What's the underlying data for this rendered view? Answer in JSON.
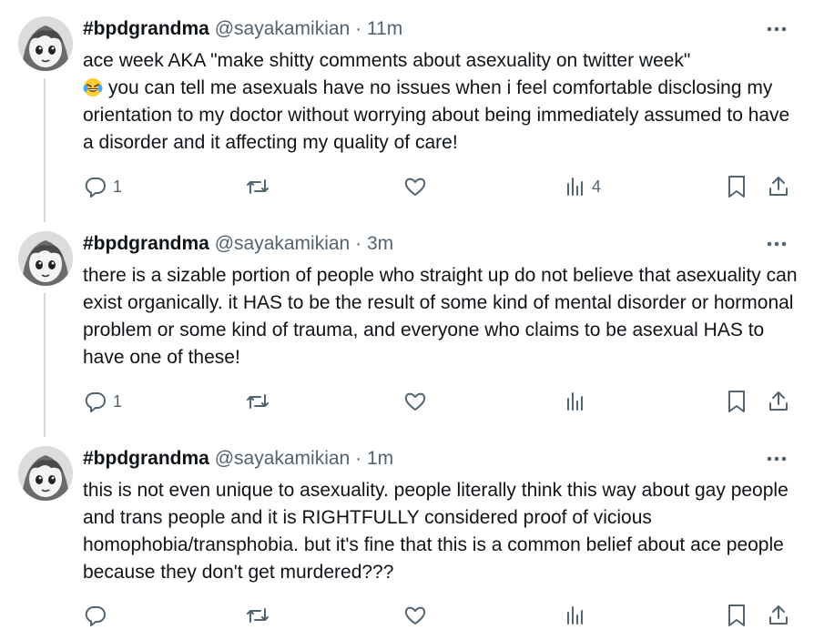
{
  "tweets": [
    {
      "name": "#bpdgrandma",
      "handle": "@sayakamikian",
      "separator": "·",
      "time": "11m",
      "text_before_emoji": "ace week AKA \"make shitty comments about asexuality on twitter week\"\n",
      "emoji": "😂",
      "text_after_emoji": " you can tell me asexuals have no issues when i feel comfortable disclosing my orientation to my doctor without worrying about being immediately assumed to have a disorder and it affecting my quality of care!",
      "reply_count": "1",
      "retweet_count": "",
      "like_count": "",
      "view_count": "4"
    },
    {
      "name": "#bpdgrandma",
      "handle": "@sayakamikian",
      "separator": "·",
      "time": "3m",
      "text": "there is a sizable portion of people who straight up do not believe that asexuality can exist organically. it HAS to be the result of some kind of mental disorder or hormonal problem or some kind of trauma, and everyone who claims to be asexual HAS to have one of these!",
      "reply_count": "1",
      "retweet_count": "",
      "like_count": "",
      "view_count": ""
    },
    {
      "name": "#bpdgrandma",
      "handle": "@sayakamikian",
      "separator": "·",
      "time": "1m",
      "text": "this is not even unique to asexuality. people literally think this way about gay people and trans people and it is RIGHTFULLY considered proof of vicious homophobia/transphobia. but it's fine that this is a common belief about ace people because they don't get murdered???",
      "reply_count": "",
      "retweet_count": "",
      "like_count": "",
      "view_count": ""
    }
  ],
  "colors": {
    "text": "#0f1419",
    "secondary": "#536471",
    "thread_line": "#cfd9de"
  },
  "icons": [
    "more-icon",
    "reply-icon",
    "retweet-icon",
    "like-icon",
    "views-icon",
    "bookmark-icon",
    "share-icon"
  ]
}
